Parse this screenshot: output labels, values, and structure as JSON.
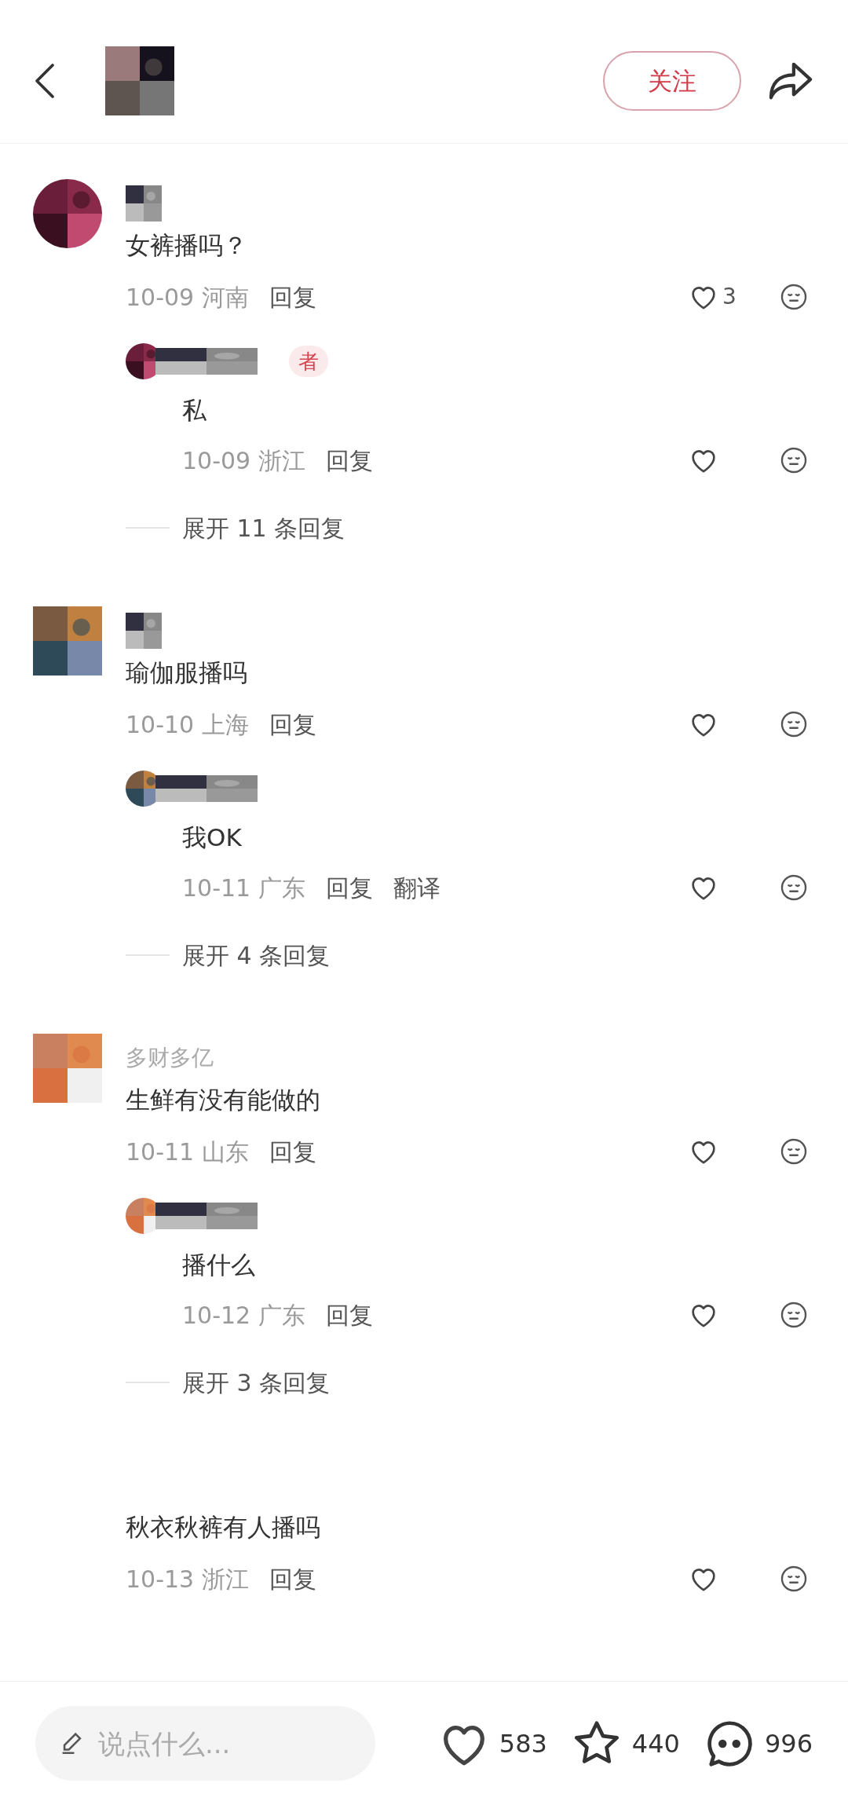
{
  "header": {
    "avatar": {
      "kind": "picture"
    },
    "follow_button": "关注"
  },
  "comments": [
    {
      "avatar": {
        "kind": "picture"
      },
      "name": {
        "kind": "picture"
      },
      "text": "女裤播吗？",
      "date": "10-09",
      "region": "河南",
      "actions": [
        "回复"
      ],
      "likes": "3",
      "replies": [
        {
          "avatar": {
            "kind": "picture"
          },
          "name": {
            "kind": "picture"
          },
          "badge": "者",
          "text": "私",
          "date": "10-09",
          "region": "浙江",
          "actions": [
            "回复"
          ]
        }
      ],
      "expand": "展开 11 条回复"
    },
    {
      "avatar": {
        "kind": "picture"
      },
      "name": {
        "kind": "picture"
      },
      "text": "瑜伽服播吗",
      "date": "10-10",
      "region": "上海",
      "actions": [
        "回复"
      ],
      "replies": [
        {
          "avatar": {
            "kind": "picture"
          },
          "name": {
            "kind": "picture"
          },
          "text": "我OK",
          "date": "10-11",
          "region": "广东",
          "actions": [
            "回复",
            "翻译"
          ]
        }
      ],
      "expand": "展开 4 条回复"
    },
    {
      "avatar": {
        "kind": "picture"
      },
      "username": "多财多亿",
      "text": "生鲜有没有能做的",
      "date": "10-11",
      "region": "山东",
      "actions": [
        "回复"
      ],
      "replies": [
        {
          "avatar": {
            "kind": "picture"
          },
          "name": {
            "kind": "picture"
          },
          "text": "播什么",
          "date": "10-12",
          "region": "广东",
          "actions": [
            "回复"
          ]
        }
      ],
      "expand": "展开 3 条回复"
    },
    {
      "text": "秋衣秋裤有人播吗",
      "date": "10-13",
      "region": "浙江",
      "actions": [
        "回复"
      ]
    }
  ],
  "bottom_bar": {
    "placeholder": "说点什么...",
    "likes": "583",
    "favorites": "440",
    "comments": "996"
  }
}
